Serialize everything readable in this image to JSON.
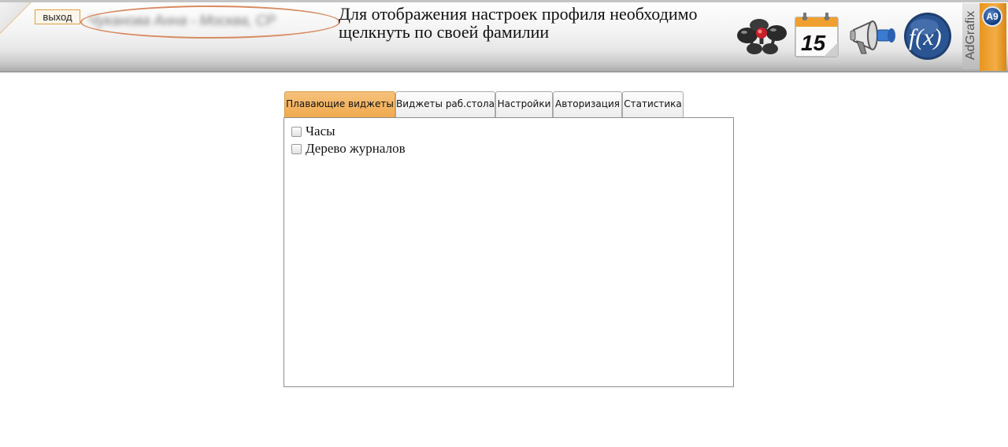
{
  "header": {
    "logout_label": "выход",
    "user_name": "Чуканова Анна - Москва, СР",
    "hint_line1": "Для отображения настроек профиля необходимо",
    "hint_line2": "щелкнуть по своей фамилии",
    "icons": [
      "molecule-icon",
      "calendar-icon",
      "megaphone-icon",
      "function-icon"
    ],
    "calendar_day": "15",
    "function_symbol": "f(x)",
    "brand_name": "AdGrafix",
    "brand_badge": "A9",
    "accent_color": "#f0a94d",
    "ellipse_color": "#d98a60"
  },
  "tabs": [
    {
      "label": "Плавающие виджеты",
      "active": true
    },
    {
      "label": "Виджеты раб.стола",
      "active": false
    },
    {
      "label": "Настройки",
      "active": false
    },
    {
      "label": "Авторизация",
      "active": false
    },
    {
      "label": "Статистика",
      "active": false
    }
  ],
  "panel": {
    "options": [
      {
        "label": "Часы",
        "checked": false
      },
      {
        "label": "Дерево журналов",
        "checked": false
      }
    ]
  }
}
